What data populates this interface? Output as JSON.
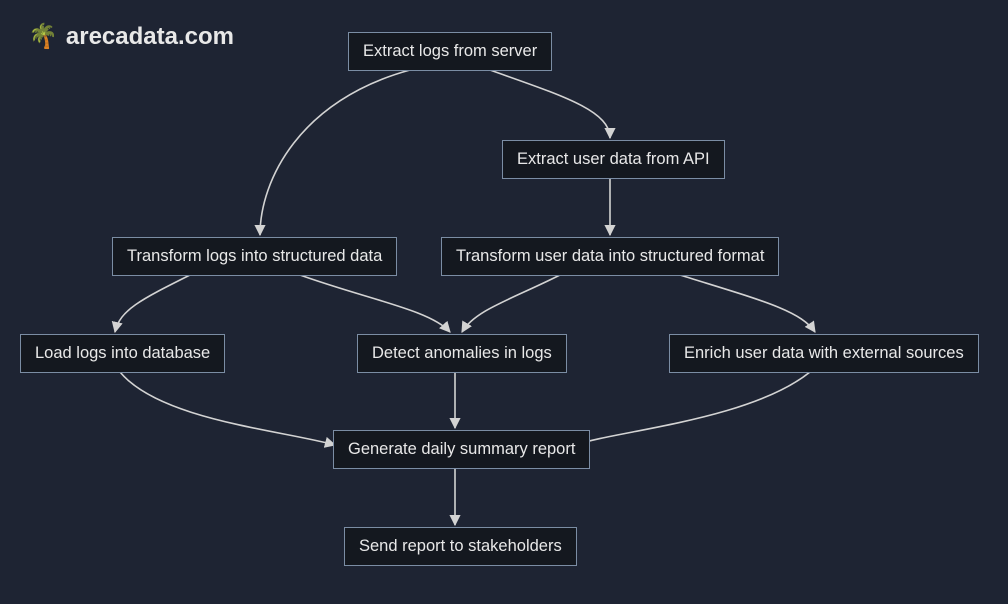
{
  "watermark": {
    "icon": "🌴",
    "text": "arecadata.com"
  },
  "nodes": {
    "extract_logs": {
      "label": "Extract logs from server"
    },
    "extract_user": {
      "label": "Extract user data from API"
    },
    "transform_logs": {
      "label": "Transform logs into structured data"
    },
    "transform_user": {
      "label": "Transform user data into structured format"
    },
    "load_logs": {
      "label": "Load logs into database"
    },
    "detect_anomalies": {
      "label": "Detect anomalies in logs"
    },
    "enrich_user": {
      "label": "Enrich user data with external sources"
    },
    "generate_report": {
      "label": "Generate daily summary report"
    },
    "send_report": {
      "label": "Send report to stakeholders"
    }
  },
  "chart_data": {
    "type": "flowchart",
    "direction": "TB",
    "nodes": [
      {
        "id": "extract_logs",
        "label": "Extract logs from server"
      },
      {
        "id": "extract_user",
        "label": "Extract user data from API"
      },
      {
        "id": "transform_logs",
        "label": "Transform logs into structured data"
      },
      {
        "id": "transform_user",
        "label": "Transform user data into structured format"
      },
      {
        "id": "load_logs",
        "label": "Load logs into database"
      },
      {
        "id": "detect_anomalies",
        "label": "Detect anomalies in logs"
      },
      {
        "id": "enrich_user",
        "label": "Enrich user data with external sources"
      },
      {
        "id": "generate_report",
        "label": "Generate daily summary report"
      },
      {
        "id": "send_report",
        "label": "Send report to stakeholders"
      }
    ],
    "edges": [
      {
        "from": "extract_logs",
        "to": "transform_logs"
      },
      {
        "from": "extract_logs",
        "to": "extract_user"
      },
      {
        "from": "extract_user",
        "to": "transform_user"
      },
      {
        "from": "transform_logs",
        "to": "load_logs"
      },
      {
        "from": "transform_logs",
        "to": "detect_anomalies"
      },
      {
        "from": "transform_user",
        "to": "detect_anomalies"
      },
      {
        "from": "transform_user",
        "to": "enrich_user"
      },
      {
        "from": "load_logs",
        "to": "generate_report"
      },
      {
        "from": "detect_anomalies",
        "to": "generate_report"
      },
      {
        "from": "enrich_user",
        "to": "generate_report"
      },
      {
        "from": "generate_report",
        "to": "send_report"
      }
    ]
  }
}
